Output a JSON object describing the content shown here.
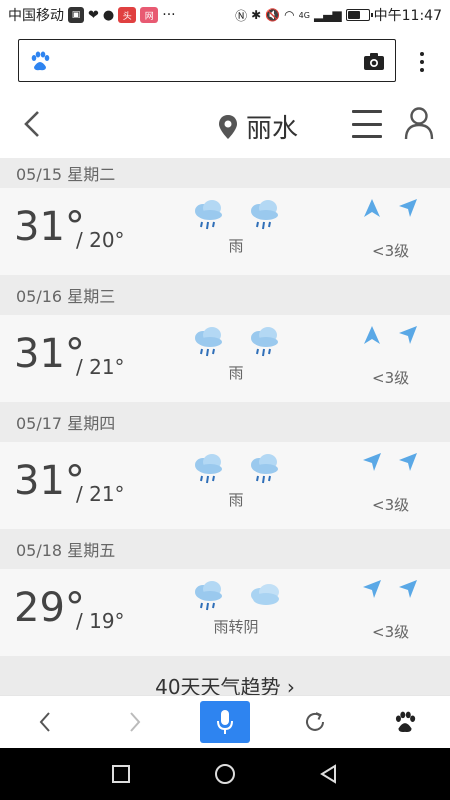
{
  "status_bar": {
    "carrier": "中国移动",
    "network_badge": "4G",
    "time": "中午11:47",
    "battery_level": 0.55
  },
  "browser": {
    "search_placeholder": ""
  },
  "header": {
    "city": "丽水"
  },
  "forecast": [
    {
      "date": "05/15 星期二",
      "high": "31°",
      "low": "/ 20°",
      "icons": [
        "rain-cloud-icon",
        "rain-cloud-icon"
      ],
      "desc": "雨",
      "wind_dirs": [
        "wind-arrow-up-icon",
        "wind-arrow-northeast-icon"
      ],
      "wind": "<3级"
    },
    {
      "date": "05/16 星期三",
      "high": "31°",
      "low": "/ 21°",
      "icons": [
        "rain-cloud-icon",
        "rain-cloud-icon"
      ],
      "desc": "雨",
      "wind_dirs": [
        "wind-arrow-up-icon",
        "wind-arrow-northeast-icon"
      ],
      "wind": "<3级"
    },
    {
      "date": "05/17 星期四",
      "high": "31°",
      "low": "/ 21°",
      "icons": [
        "rain-cloud-icon",
        "rain-cloud-icon"
      ],
      "desc": "雨",
      "wind_dirs": [
        "wind-arrow-northeast-icon",
        "wind-arrow-northeast-icon"
      ],
      "wind": "<3级"
    },
    {
      "date": "05/18 星期五",
      "high": "29°",
      "low": "/ 19°",
      "icons": [
        "rain-cloud-icon",
        "cloudy-icon"
      ],
      "desc": "雨转阴",
      "wind_dirs": [
        "wind-arrow-northeast-icon",
        "wind-arrow-northeast-icon"
      ],
      "wind": "<3级"
    }
  ],
  "trend_link": "40天天气趋势 ›",
  "colors": {
    "accent_blue": "#2e84f0",
    "icon_blue": "#5aa8e6"
  }
}
